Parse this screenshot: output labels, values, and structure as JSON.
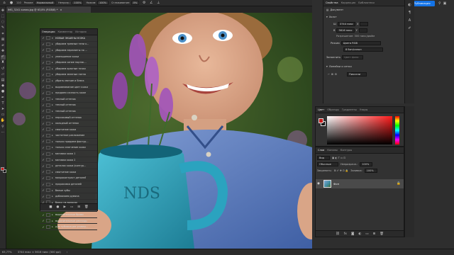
{
  "optionbar": {
    "mode_label": "Режим:",
    "mode_value": "Нормальный",
    "opacity_label": "Непрозр.:",
    "opacity_value": "100%",
    "pressure_label": "Нажим:",
    "pressure_value": "100%",
    "smooth_label": "Сглаживание:",
    "smooth_value": "0%",
    "brush_size": "110"
  },
  "document_tab": {
    "title": "IMG_3241 копия.jpg @ 63,8% (RGB/8) *"
  },
  "tools": [
    "move-icon",
    "marquee-icon",
    "lasso-icon",
    "quick-select-icon",
    "crop-icon",
    "frame-icon",
    "eyedropper-icon",
    "healing-icon",
    "brush-icon",
    "clone-stamp-icon",
    "history-brush-icon",
    "eraser-icon",
    "gradient-icon",
    "blur-icon",
    "dodge-icon",
    "pen-icon",
    "type-icon",
    "path-select-icon",
    "rectangle-icon",
    "hand-icon",
    "zoom-icon",
    "more-icon"
  ],
  "colors": {
    "foreground": "#c81c1c",
    "background": "#111111",
    "accent": "#1473e6"
  },
  "actions_panel": {
    "tabs": [
      "Операции",
      "Комментар",
      "История"
    ],
    "set_name": "НОВЫЕ ЭКШЕНЫ КОЖА",
    "items": [
      "убираем тревные тени к...",
      "убираем пересветы на ...",
      "уменьшение кожи",
      "убираем синие портак...",
      "убираем красные точки",
      "убираем зеленые пятна",
      "убрать мягкие и блеск",
      "выравнивание цвет кожи",
      "придаем сочность коже",
      "теплый оттенок",
      "теплый оттенок",
      "теплый оттенок",
      "персиковый оттенок",
      "холодный оттенок",
      "смягчение кожи",
      "частотное разложение",
      "только придаем фактур...",
      "только смягчение кожи",
      "матовая кожа 1",
      "матовая кожа 2",
      "деталях кожи (контур...",
      "смягчение кожи",
      "микроконтраст деталей",
      "прорисовка деталей",
      "белые зубы",
      "добавляем румяна",
      "блеск на волосах",
      "блеск глаз",
      "выразительные брови",
      "выразительные ресницы",
      "для публикации универ..."
    ]
  },
  "properties_panel": {
    "tabs": [
      "Свойства",
      "Коррекция",
      "Библиотеки"
    ],
    "doc_label": "Документ",
    "width_label": "Ш",
    "width_value": "3744 пикс",
    "x_label": "X",
    "height_label": "В",
    "height_value": "5616 пикс",
    "y_label": "Y",
    "resolution": "Разрешение: 300 пикс/дюйм",
    "mode_label": "Режим",
    "mode_value": "Цвета RGB",
    "bits_value": "8 бит/канал",
    "fill_label": "Заполнить",
    "bg_color": "Цвет фона",
    "canvas_header": "Холст",
    "guides_header": "Линейки и сетки",
    "guides_value": "Пиксели"
  },
  "publish_button": "Публикация",
  "color_panel": {
    "tabs": [
      "Цвет",
      "Образцы",
      "Градиенты",
      "Узоры"
    ]
  },
  "layers_panel": {
    "tabs": [
      "Слои",
      "Каналы",
      "Контуры"
    ],
    "search_placeholder": "Вид",
    "blend_value": "Обычные",
    "opacity_label": "Непрозрачн.:",
    "opacity_value": "100%",
    "lock_label": "Закрепить:",
    "fill_label": "Заливка:",
    "fill_value": "100%",
    "layer_name": "Фон"
  },
  "statusbar": {
    "zoom": "63,77%",
    "doc_size": "3744 пикс × 5616 пикс (300 ppi)"
  }
}
